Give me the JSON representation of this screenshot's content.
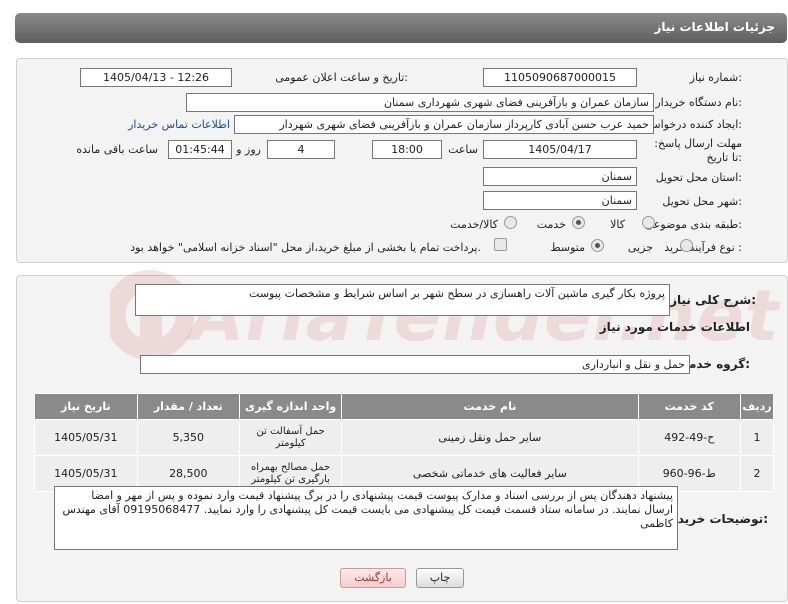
{
  "header": {
    "title": "جزئیات اطلاعات نیاز"
  },
  "form": {
    "need_number_label": "شماره نیاز:",
    "need_number": "1105090687000015",
    "announce_label": "تاریخ و ساعت اعلان عمومی:",
    "announce_value": "1405/04/13 - 12:26",
    "buyer_org_label": "نام دستگاه خریدار:",
    "buyer_org": "سازمان عمران و بازآفرینی فضای شهری شهرداری سمنان",
    "creator_label": "ایجاد کننده درخواست:",
    "creator": "حمید عرب حسن آبادی کارپرداز سازمان عمران و بازآفرینی فضای شهری شهردار",
    "contact_link": "اطلاعات تماس خریدار",
    "deadline_label": "مهلت ارسال پاسخ: تا تاریخ:",
    "deadline_date": "1405/04/17",
    "time_label": "ساعت",
    "deadline_time": "18:00",
    "days_value": "4",
    "days_label": "روز و",
    "remaining_time": "01:45:44",
    "remaining_label": "ساعت باقی مانده",
    "province_label": "استان محل تحویل:",
    "province": "سمنان",
    "city_label": "شهر محل تحویل:",
    "city": "سمنان",
    "category_label": "طبقه بندی موضوعی:",
    "category_options": [
      "کالا",
      "خدمت",
      "کالا/خدمت"
    ],
    "category_selected": "خدمت",
    "purchase_label": "نوع فرآیند خرید :",
    "purchase_options": [
      "جزیی",
      "متوسط"
    ],
    "purchase_selected": "متوسط",
    "payment_note": "پرداخت تمام یا بخشی از مبلغ خرید،از محل \"اسناد خزانه اسلامی\" خواهد بود."
  },
  "description": {
    "label": "شرح کلی نیاز:",
    "text": "پروژه بکار گیری ماشین آلات راهسازی در سطح شهر بر اساس شرایط و مشخصات پیوست"
  },
  "services": {
    "section_title": "اطلاعات خدمات مورد نیاز",
    "group_label": "گروه خدمت:",
    "group_value": "حمل و نقل و انبارداری",
    "columns": [
      "ردیف",
      "کد خدمت",
      "نام خدمت",
      "واحد اندازه گیری",
      "تعداد / مقدار",
      "تاریخ نیاز"
    ],
    "rows": [
      {
        "index": "1",
        "code": "ح-49-492",
        "name": "سایر حمل ونقل زمینی",
        "unit": "حمل آسفالت تن کیلومتر",
        "qty": "5,350",
        "date": "1405/05/31"
      },
      {
        "index": "2",
        "code": "ط-96-960",
        "name": "سایر فعالیت های خدماتی شخصی",
        "unit": "حمل مصالح بهمراه بارگیری تن کیلومتر",
        "qty": "28,500",
        "date": "1405/05/31"
      }
    ]
  },
  "buyer_notes": {
    "label": "توضیحات خریدار:",
    "text": "پیشنهاد دهندگان پس از بررسی اسناد و مدارک پیوست قیمت پیشنهادی  را در برگ پیشنهاد قیمت وارد نموده و پس از مهر و امضا ارسال نمایند. در سامانه ستاد قسمت قیمت کل پیشنهادی می بایست قیمت کل پیشنهادی را وارد نمایید. 09195068477 آقای مهندس کاظمی"
  },
  "buttons": {
    "print": "چاپ",
    "back": "بازگشت"
  },
  "watermark": {
    "text": "AriaTender.net"
  }
}
